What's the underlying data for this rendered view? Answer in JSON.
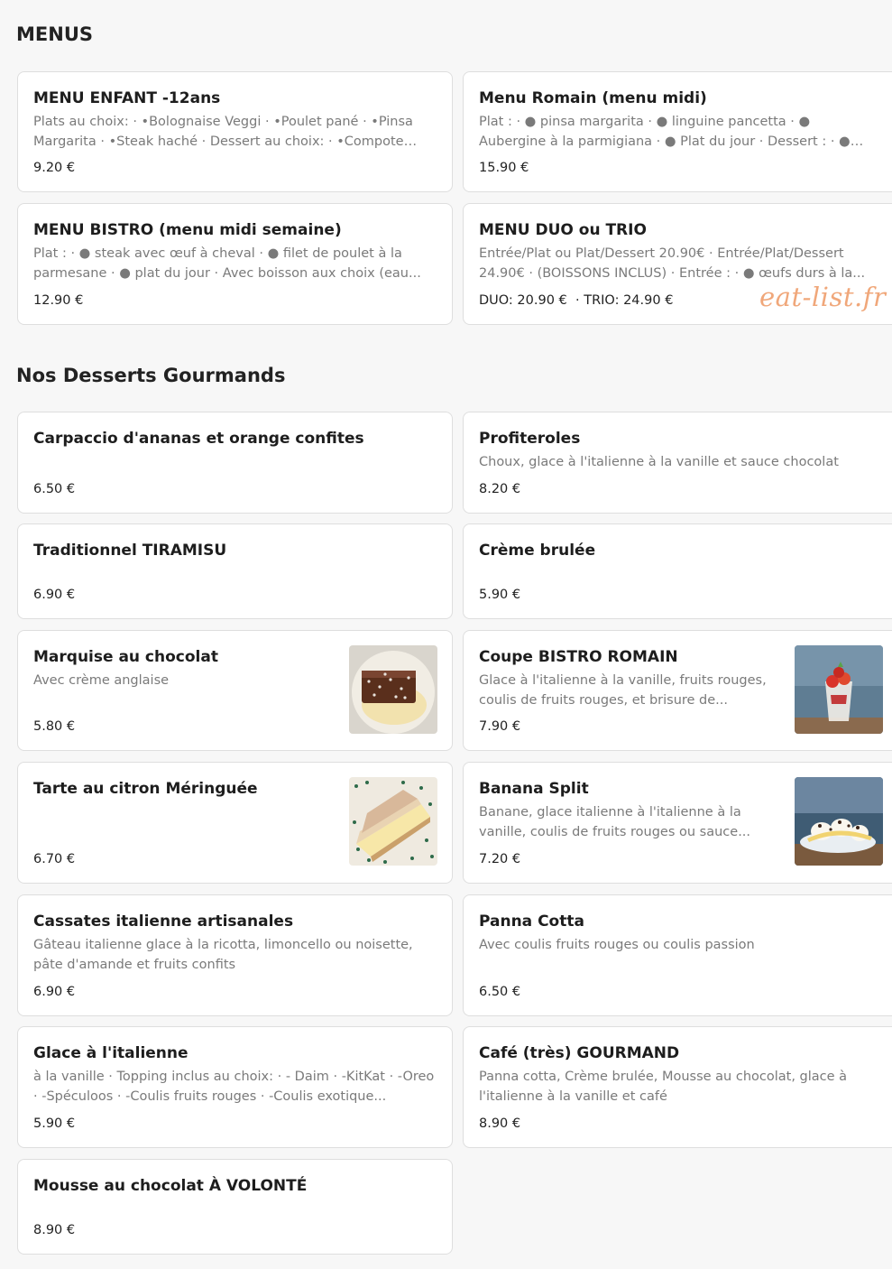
{
  "sections": {
    "menus_title": "MENUS",
    "desserts_title": "Nos Desserts Gourmands"
  },
  "menus": [
    {
      "name": "MENU ENFANT -12ans",
      "desc": "Plats au choix: · •Bolognaise Veggi · •Poulet pané · •Pinsa Margarita · •Steak haché · Dessert au choix: · •Compote de...",
      "price": "9.20 €"
    },
    {
      "name": "Menu Romain (menu midi)",
      "desc": "Plat : · ● pinsa margarita · ● linguine pancetta · ● Aubergine à la parmigiana · ● Plat du jour · Dessert : · ● Mousse au...",
      "price": "15.90 €"
    },
    {
      "name": "MENU BISTRO (menu midi semaine)",
      "desc": "Plat : · ● steak avec œuf à cheval · ● filet de poulet à la parmesane · ● plat du jour · Avec boisson aux choix (eau...",
      "price": "12.90 €"
    },
    {
      "name": "MENU DUO ou TRIO",
      "desc": "Entrée/Plat ou Plat/Dessert 20.90€ · Entrée/Plat/Dessert 24.90€ · (BOISSONS INCLUS) · Entrée : · ● œufs durs à la...",
      "price": "DUO: 20.90 €  · TRIO: 24.90 €"
    }
  ],
  "watermark": "eat-list.fr",
  "desserts": [
    {
      "name": "Carpaccio d'ananas et orange confites",
      "desc": "",
      "price": "6.50 €"
    },
    {
      "name": "Profiteroles",
      "desc": "Choux, glace à l'italienne à la vanille et sauce chocolat",
      "price": "8.20 €"
    },
    {
      "name": "Traditionnel TIRAMISU",
      "desc": "",
      "price": "6.90 €"
    },
    {
      "name": "Crème brulée",
      "desc": "",
      "price": "5.90 €"
    },
    {
      "name": "Marquise au chocolat",
      "desc": "Avec crème anglaise",
      "price": "5.80 €",
      "image": "chocolate-marquise-photo"
    },
    {
      "name": "Coupe BISTRO ROMAIN",
      "desc": "Glace à l'italienne à la vanille, fruits rouges, coulis de fruits rouges, et brisure de...",
      "price": "7.90 €",
      "image": "sundae-cup-photo"
    },
    {
      "name": "Tarte au citron Méringuée",
      "desc": "",
      "price": "6.70 €",
      "image": "lemon-tart-photo"
    },
    {
      "name": "Banana Split",
      "desc": "Banane, glace italienne à l'italienne à la vanille, coulis de fruits rouges ou sauce...",
      "price": "7.20 €",
      "image": "banana-split-photo"
    },
    {
      "name": "Cassates italienne artisanales",
      "desc": "Gâteau italienne glace à la ricotta, limoncello ou noisette, pâte d'amande et fruits confits",
      "price": "6.90 €"
    },
    {
      "name": "Panna Cotta",
      "desc": "Avec coulis fruits rouges ou coulis passion",
      "price": "6.50 €"
    },
    {
      "name": "Glace à l'italienne",
      "desc": "à la vanille · Topping inclus au choix: · - Daim · -KitKat · -Oreo · -Spéculoos · -Coulis fruits rouges · -Coulis exotique...",
      "price": "5.90 €"
    },
    {
      "name": "Café (très) GOURMAND",
      "desc": "Panna cotta, Crème brulée, Mousse au chocolat, glace à l'italienne à la vanille et café",
      "price": "8.90 €"
    },
    {
      "name": "Mousse au chocolat À VOLONTÉ",
      "desc": "",
      "price": "8.90 €"
    }
  ]
}
